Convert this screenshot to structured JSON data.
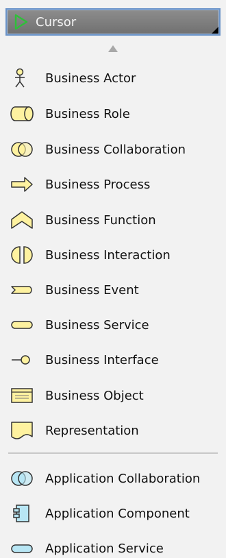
{
  "cursor": {
    "label": "Cursor",
    "icon": "cursor-arrow-icon",
    "accent": "#6a93c8"
  },
  "scroll": {
    "icon": "scroll-up-arrow-icon"
  },
  "business_items": [
    {
      "label": "Business Actor",
      "icon": "business-actor-icon"
    },
    {
      "label": "Business Role",
      "icon": "business-role-icon"
    },
    {
      "label": "Business Collaboration",
      "icon": "business-collaboration-icon"
    },
    {
      "label": "Business Process",
      "icon": "business-process-icon"
    },
    {
      "label": "Business Function",
      "icon": "business-function-icon"
    },
    {
      "label": "Business Interaction",
      "icon": "business-interaction-icon"
    },
    {
      "label": "Business Event",
      "icon": "business-event-icon"
    },
    {
      "label": "Business Service",
      "icon": "business-service-icon"
    },
    {
      "label": "Business Interface",
      "icon": "business-interface-icon"
    },
    {
      "label": "Business Object",
      "icon": "business-object-icon"
    },
    {
      "label": "Representation",
      "icon": "representation-icon"
    }
  ],
  "application_items": [
    {
      "label": "Application Collaboration",
      "icon": "application-collaboration-icon"
    },
    {
      "label": "Application Component",
      "icon": "application-component-icon"
    },
    {
      "label": "Application Service",
      "icon": "application-service-icon"
    }
  ],
  "colors": {
    "business_yellow": "#fef2a0",
    "application_blue": "#b8e6f4"
  }
}
